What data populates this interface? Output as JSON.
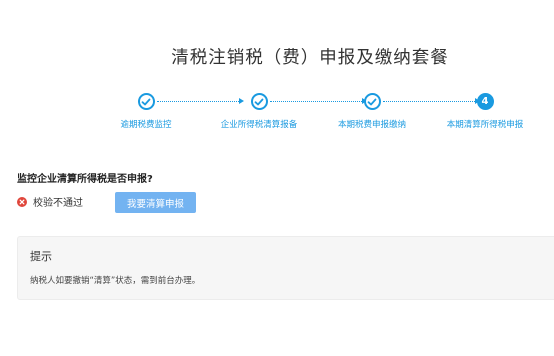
{
  "header": {
    "title": "清税注销税（费）申报及缴纳套餐"
  },
  "stepper": {
    "steps": [
      {
        "label": "逾期税费监控",
        "state": "done"
      },
      {
        "label": "企业所得税清算报备",
        "state": "done"
      },
      {
        "label": "本期税费申报缴纳",
        "state": "done"
      },
      {
        "label": "本期清算所得税申报",
        "state": "active",
        "number": "4"
      }
    ],
    "accent_color": "#1a9ae0"
  },
  "main": {
    "question": "监控企业清算所得税是否申报?",
    "status_text": "校验不通过",
    "status_icon": "error-circle-icon",
    "status_color": "#e0463b",
    "action_button_label": "我要清算申报",
    "action_button_color": "#73b3f1"
  },
  "tip": {
    "title": "提示",
    "text": "纳税人如要撤销“清算”状态，需到前台办理。"
  }
}
